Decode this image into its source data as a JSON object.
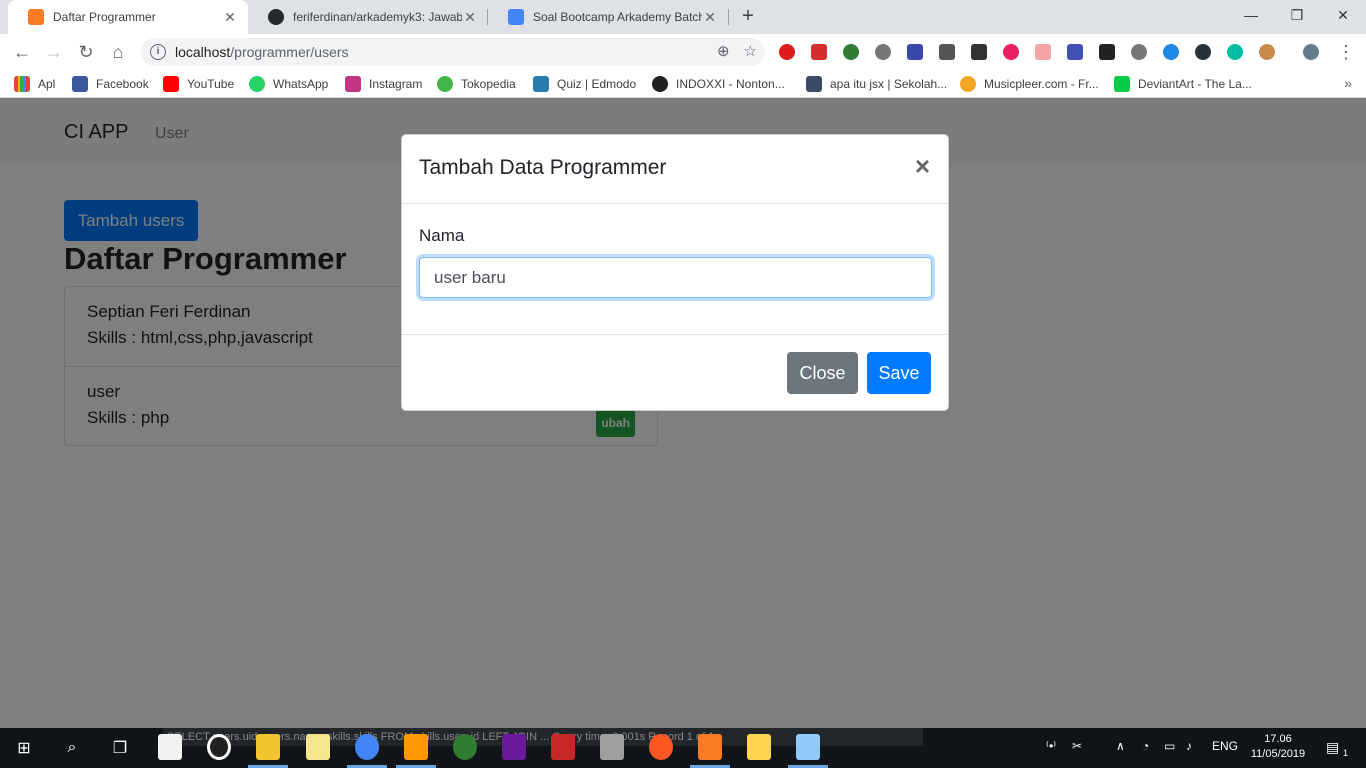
{
  "browser": {
    "tabs": [
      {
        "title": "Daftar Programmer",
        "favicon_color": "#fb7a24"
      },
      {
        "title": "feriferdinan/arkademyk3: Jawaba",
        "favicon_color": "#24292e"
      },
      {
        "title": "Soal Bootcamp Arkademy Batch",
        "favicon_color": "#4285f4"
      }
    ],
    "url_host": "localhost",
    "url_path": "/programmer/users",
    "bookmarks": [
      {
        "label": "Apl",
        "color": "#ea4335"
      },
      {
        "label": "Facebook",
        "color": "#3b5998"
      },
      {
        "label": "YouTube",
        "color": "#ff0000"
      },
      {
        "label": "WhatsApp",
        "color": "#25d366"
      },
      {
        "label": "Instagram",
        "color": "#c13584"
      },
      {
        "label": "Tokopedia",
        "color": "#42b549"
      },
      {
        "label": "Quiz | Edmodo",
        "color": "#2a7ab0"
      },
      {
        "label": "INDOXXI - Nonton...",
        "color": "#222222"
      },
      {
        "label": "apa itu jsx | Sekolah...",
        "color": "#3d4b6a"
      },
      {
        "label": "Musicpleer.com - Fr...",
        "color": "#f5a623"
      },
      {
        "label": "DeviantArt - The La...",
        "color": "#05cc47"
      }
    ]
  },
  "page": {
    "brand": "CI APP",
    "nav_user": "User",
    "add_button": "Tambah users",
    "title": "Daftar Programmer",
    "programmers": [
      {
        "name": "Septian Feri Ferdinan",
        "skills": "Skills : html,css,php,javascript"
      },
      {
        "name": "user",
        "skills": "Skills : php",
        "badge": "ubah"
      }
    ]
  },
  "modal": {
    "title": "Tambah Data Programmer",
    "close_symbol": "×",
    "label": "Nama",
    "input_value": "user baru",
    "close_button": "Close",
    "save_button": "Save"
  },
  "taskbar": {
    "overlay_text": "SELECT users.uid, users.name, skills.skills FROM skills.user_id LEFT JOIN ...   Query time: 0.001s   Record 1 of 1",
    "lang": "ENG",
    "time": "17.06",
    "date": "11/05/2019",
    "notification_count": "1"
  }
}
